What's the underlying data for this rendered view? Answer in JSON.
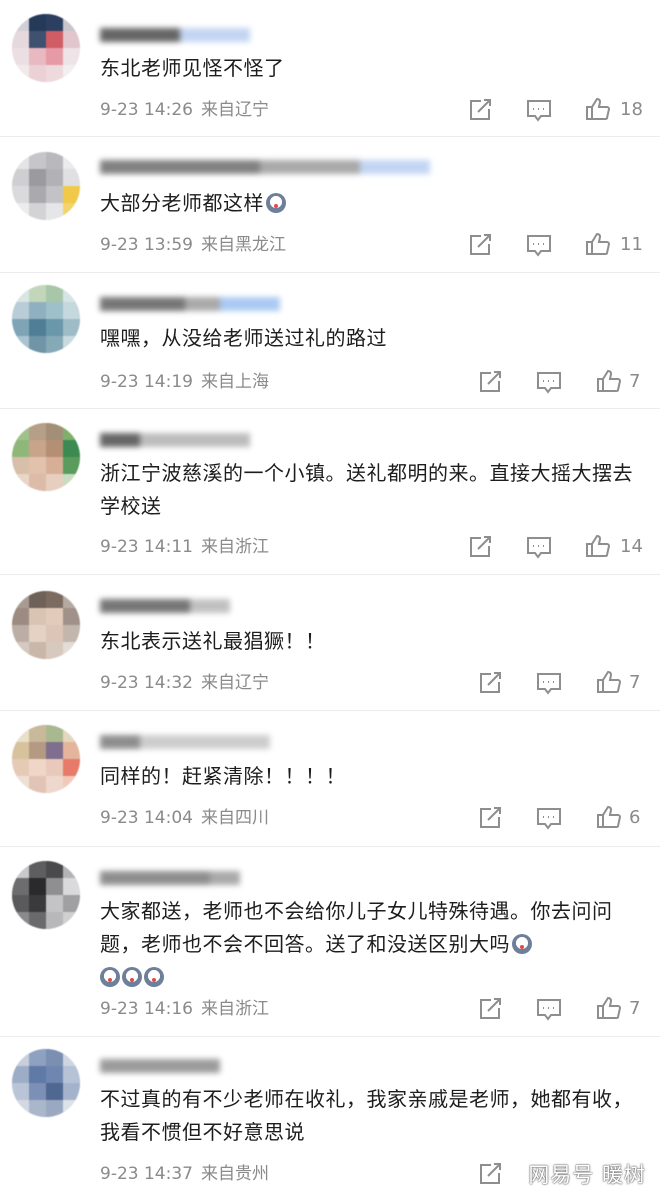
{
  "comments": [
    {
      "text": "东北老师见怪不怪了",
      "date": "9-23 14:26",
      "location": "来自辽宁",
      "likes": "18",
      "emoji": 0
    },
    {
      "text": "大部分老师都这样",
      "date": "9-23 13:59",
      "location": "来自黑龙江",
      "likes": "11",
      "emoji": 1
    },
    {
      "text": "嘿嘿，从没给老师送过礼的路过",
      "date": "9-23 14:19",
      "location": "来自上海",
      "likes": "7",
      "emoji": 0
    },
    {
      "text": "浙江宁波慈溪的一个小镇。送礼都明的来。直接大摇大摆去学校送",
      "date": "9-23 14:11",
      "location": "来自浙江",
      "likes": "14",
      "emoji": 0
    },
    {
      "text": "东北表示送礼最猖獗！！",
      "date": "9-23 14:32",
      "location": "来自辽宁",
      "likes": "7",
      "emoji": 0
    },
    {
      "text": "同样的！赶紧清除！！！！",
      "date": "9-23 14:04",
      "location": "来自四川",
      "likes": "6",
      "emoji": 0
    },
    {
      "text": "大家都送，老师也不会给你儿子女儿特殊待遇。你去问问题，老师也不会不回答。送了和没送区别大吗",
      "date": "9-23 14:16",
      "location": "来自浙江",
      "likes": "7",
      "emoji": 4
    },
    {
      "text": "不过真的有不少老师在收礼，我家亲戚是老师，她都有收，我看不惯但不好意思说",
      "date": "9-23 14:37",
      "location": "来自贵州",
      "likes": "",
      "emoji": 0
    }
  ],
  "watermark": "网易号 暖树",
  "icons": {
    "share": "share-icon",
    "reply": "comment-icon",
    "like": "thumbs-up-icon"
  },
  "colors": {
    "text": "#1d1d1d",
    "meta": "#8a8a8a",
    "icon": "#8e8e8e",
    "divider": "#ececec"
  }
}
